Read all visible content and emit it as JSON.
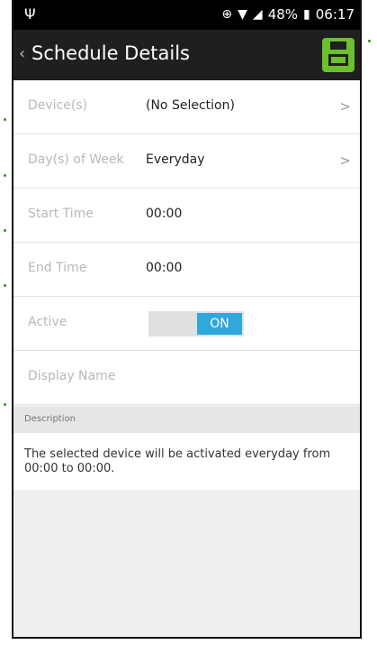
{
  "status_bar": {
    "usb_icon": "usb-icon",
    "battery_percent": "48%",
    "time": "06:17",
    "icons": [
      "data-saver-icon",
      "wifi-icon",
      "signal-icon",
      "battery-icon"
    ]
  },
  "app_bar": {
    "back_icon": "chevron-left-icon",
    "title": "Schedule Details",
    "save_icon": "save-icon",
    "accent": "#6cbf2d"
  },
  "rows": [
    {
      "label": "Device(s)",
      "value": "(No Selection)",
      "chevron": ">"
    },
    {
      "label": "Day(s) of Week",
      "value": "Everyday",
      "chevron": ">"
    },
    {
      "label": "Start Time",
      "value": "00:00"
    },
    {
      "label": "End Time",
      "value": "00:00"
    },
    {
      "label": "Active",
      "toggle": "ON"
    },
    {
      "label": "Display Name",
      "value": ""
    }
  ],
  "description": {
    "header": "Description",
    "text": "The selected device will be activated everyday from 00:00 to 00:00."
  },
  "colors": {
    "toggle_on": "#2fa8dc",
    "app_bar_bg": "#1f1f1f"
  }
}
